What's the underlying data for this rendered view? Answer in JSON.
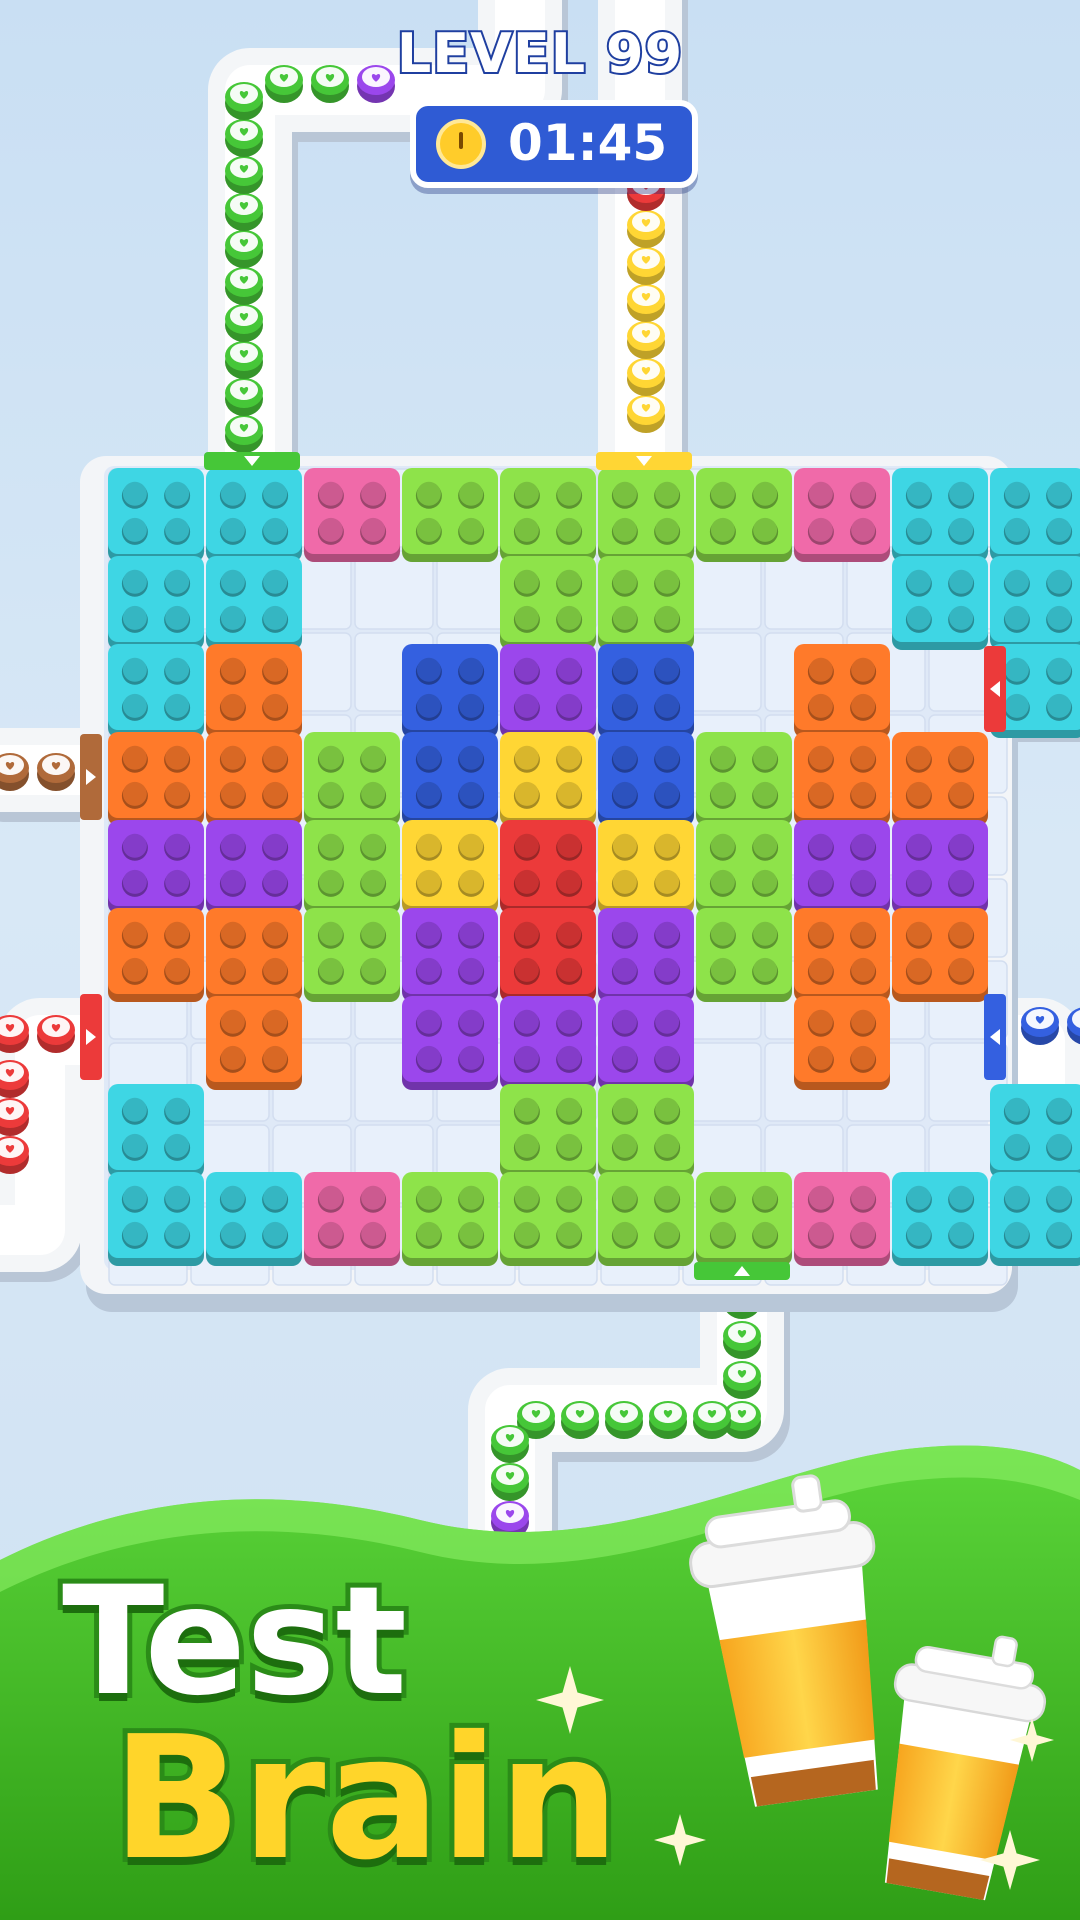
{
  "hud": {
    "level_label": "LEVEL 99",
    "timer_value": "01:45"
  },
  "tagline": {
    "line1": "Test",
    "line2": "Brain"
  },
  "colors": {
    "cyan": "#3ed6e4",
    "pink": "#f06aa9",
    "lime": "#8ee34a",
    "orange": "#ff7a2a",
    "blue": "#3460e0",
    "purple": "#9b47ec",
    "yellow": "#ffd634",
    "red": "#ec3a3a",
    "green": "#46c738",
    "brown": "#b06a3a"
  },
  "board": {
    "pieces": [
      {
        "id": "cyan-top-left",
        "color": "cyan"
      },
      {
        "id": "pink-top-left",
        "color": "pink"
      },
      {
        "id": "lime-top-t",
        "color": "lime"
      },
      {
        "id": "pink-top-right",
        "color": "pink"
      },
      {
        "id": "cyan-top-right",
        "color": "cyan"
      },
      {
        "id": "orange-left-upper",
        "color": "orange"
      },
      {
        "id": "blue-center-left",
        "color": "blue"
      },
      {
        "id": "purple-center-top",
        "color": "purple"
      },
      {
        "id": "blue-center-right",
        "color": "blue"
      },
      {
        "id": "orange-right-upper",
        "color": "orange"
      },
      {
        "id": "lime-left-column",
        "color": "lime"
      },
      {
        "id": "yellow-center-top",
        "color": "yellow"
      },
      {
        "id": "lime-right-column",
        "color": "lime"
      },
      {
        "id": "purple-left-bar",
        "color": "purple"
      },
      {
        "id": "yellow-center-left",
        "color": "yellow"
      },
      {
        "id": "red-center",
        "color": "red"
      },
      {
        "id": "yellow-center-right",
        "color": "yellow"
      },
      {
        "id": "purple-right-bar",
        "color": "purple"
      },
      {
        "id": "orange-left-lower",
        "color": "orange"
      },
      {
        "id": "purple-center-u",
        "color": "purple"
      },
      {
        "id": "orange-right-lower",
        "color": "orange"
      },
      {
        "id": "cyan-bottom-left",
        "color": "cyan"
      },
      {
        "id": "pink-bottom-left",
        "color": "pink"
      },
      {
        "id": "lime-bottom-t",
        "color": "lime"
      },
      {
        "id": "pink-bottom-right",
        "color": "pink"
      },
      {
        "id": "cyan-bottom-right",
        "color": "cyan"
      }
    ],
    "gates": [
      {
        "id": "gate-top-left",
        "color": "green"
      },
      {
        "id": "gate-top-right",
        "color": "yellow"
      },
      {
        "id": "gate-right-upper",
        "color": "red"
      },
      {
        "id": "gate-left-upper",
        "color": "brown"
      },
      {
        "id": "gate-left-lower",
        "color": "red"
      },
      {
        "id": "gate-right-lower",
        "color": "blue"
      },
      {
        "id": "gate-bottom",
        "color": "green"
      }
    ]
  },
  "queues": [
    {
      "id": "queue-top-left",
      "colors": [
        "green",
        "green",
        "green",
        "green",
        "green",
        "green",
        "green",
        "green",
        "green",
        "green",
        "green",
        "green",
        "purple"
      ]
    },
    {
      "id": "queue-top-right",
      "colors": [
        "yellow",
        "yellow",
        "yellow",
        "yellow",
        "yellow",
        "yellow",
        "red",
        "red"
      ]
    },
    {
      "id": "queue-right-upper",
      "colors": [
        "red",
        "red"
      ]
    },
    {
      "id": "queue-left-upper",
      "colors": [
        "brown",
        "brown"
      ]
    },
    {
      "id": "queue-left-lower",
      "colors": [
        "red",
        "red",
        "red",
        "red",
        "red"
      ]
    },
    {
      "id": "queue-right-lower",
      "colors": [
        "blue",
        "blue"
      ]
    },
    {
      "id": "queue-bottom",
      "colors": [
        "green",
        "green",
        "green",
        "green",
        "green",
        "green",
        "green",
        "green",
        "green",
        "green",
        "green",
        "purple",
        "purple"
      ]
    }
  ],
  "decor": {
    "cup_icon": "coffee-cup-icon",
    "sparkle_icon": "sparkle-icon",
    "heart_icon": "heart-icon"
  }
}
